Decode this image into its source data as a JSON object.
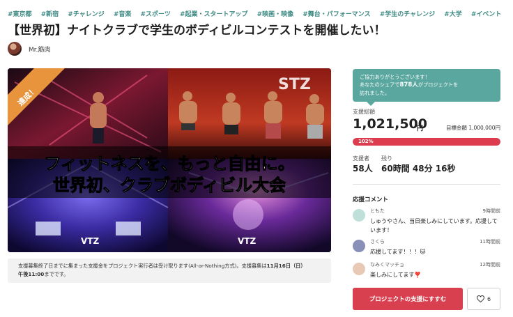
{
  "tags": [
    "#東京都",
    "#新宿",
    "#チャレンジ",
    "#音楽",
    "#スポーツ",
    "#起業・スタートアップ",
    "#映画・映像",
    "#舞台・パフォーマンス",
    "#学生のチャレンジ",
    "#大学",
    "#イベント"
  ],
  "title": "【世界初】ナイトクラブで学生のボディビルコンテストを開催したい！",
  "owner": {
    "name": "Mr.筋肉"
  },
  "hero": {
    "ribbon": "達成！",
    "headline_1": "フィットネスを、もっと自由に。",
    "headline_2": "世界初、クラブボディビル大会",
    "logo_text": "VTZ"
  },
  "notice": {
    "text_1": "支援募集終了日までに集まった支援金をプロジェクト実行者は受け取ります(All-or-Nothing方式)。支援募集は",
    "deadline_date": "11月16日（日）",
    "deadline_time": "午後11:00",
    "text_2": "までです。"
  },
  "thanks": {
    "line_1": "ご協力ありがとうございます！",
    "line_2_prefix": "あなたのシェアで",
    "count": "878人",
    "line_2_suffix": "がプロジェクトを",
    "line_3": "訪れました。"
  },
  "stats": {
    "total_label": "支援総額",
    "total_amount": "1,021,500",
    "total_unit": "円",
    "goal_label": "目標金額",
    "goal_amount": "1,000,000円",
    "progress_text": "102%",
    "progress_value": 1.0,
    "supporters_label": "支援者",
    "supporters_value": "58人",
    "remaining_label": "残り",
    "remaining_value": "60時間 48分 16秒"
  },
  "comments": {
    "title": "応援コメント",
    "items": [
      {
        "name": "ともた",
        "time": "9時間前",
        "text": "しゅうやさん、当日楽しみにしています。応援しています！",
        "avatar_color": "#bfe0d8"
      },
      {
        "name": "さくら",
        "time": "11時間前",
        "text": "応援してます！！！🐱",
        "avatar_color": "#8a8fb8"
      },
      {
        "name": "なみくマッチョ",
        "time": "12時間前",
        "text": "楽しみにしてます❣️",
        "avatar_color": "#e8c9b5"
      }
    ]
  },
  "actions": {
    "support_label": "プロジェクトの支援にすすむ",
    "like_count": "6"
  }
}
